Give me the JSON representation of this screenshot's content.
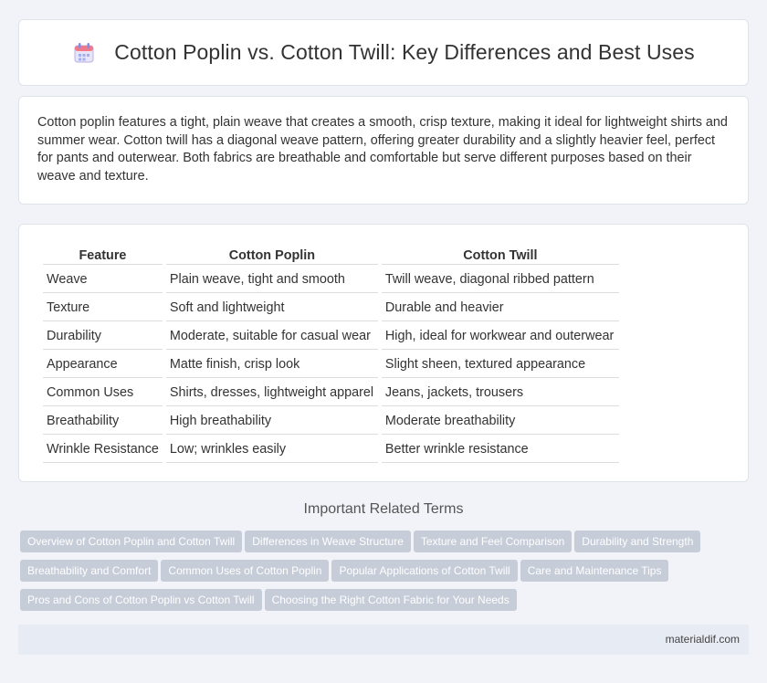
{
  "header": {
    "title": "Cotton Poplin vs. Cotton Twill: Key Differences and Best Uses",
    "icon": "calendar-icon"
  },
  "intro": {
    "text": "Cotton poplin features a tight, plain weave that creates a smooth, crisp texture, making it ideal for lightweight shirts and summer wear. Cotton twill has a diagonal weave pattern, offering greater durability and a slightly heavier feel, perfect for pants and outerwear. Both fabrics are breathable and comfortable but serve different purposes based on their weave and texture."
  },
  "table": {
    "headers": [
      "Feature",
      "Cotton Poplin",
      "Cotton Twill"
    ],
    "rows": [
      [
        "Weave",
        "Plain weave, tight and smooth",
        "Twill weave, diagonal ribbed pattern"
      ],
      [
        "Texture",
        "Soft and lightweight",
        "Durable and heavier"
      ],
      [
        "Durability",
        "Moderate, suitable for casual wear",
        "High, ideal for workwear and outerwear"
      ],
      [
        "Appearance",
        "Matte finish, crisp look",
        "Slight sheen, textured appearance"
      ],
      [
        "Common Uses",
        "Shirts, dresses, lightweight apparel",
        "Jeans, jackets, trousers"
      ],
      [
        "Breathability",
        "High breathability",
        "Moderate breathability"
      ],
      [
        "Wrinkle Resistance",
        "Low; wrinkles easily",
        "Better wrinkle resistance"
      ]
    ]
  },
  "related": {
    "title": "Important Related Terms",
    "tags": [
      "Overview of Cotton Poplin and Cotton Twill",
      "Differences in Weave Structure",
      "Texture and Feel Comparison",
      "Durability and Strength",
      "Breathability and Comfort",
      "Common Uses of Cotton Poplin",
      "Popular Applications of Cotton Twill",
      "Care and Maintenance Tips",
      "Pros and Cons of Cotton Poplin vs Cotton Twill",
      "Choosing the Right Cotton Fabric for Your Needs"
    ]
  },
  "footer": {
    "site": "materialdif.com"
  }
}
